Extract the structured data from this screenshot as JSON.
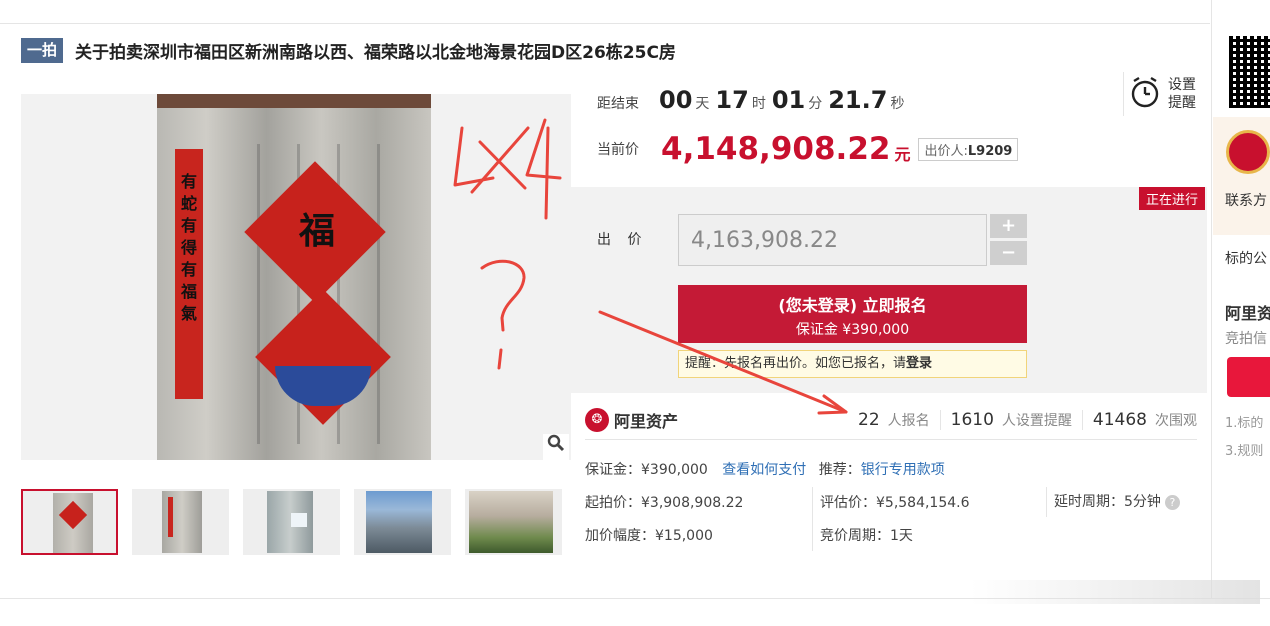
{
  "header": {
    "badge": "一拍",
    "title": "关于拍卖深圳市福田区新洲南路以西、福荣路以北金地海景花园D区26栋25C房"
  },
  "gallery": {
    "photo_text": {
      "couplet": "有蛇有得有福氣",
      "fu": "福"
    },
    "thumbnail_count": 5
  },
  "countdown": {
    "label": "距结束",
    "days": "00",
    "days_unit": "天",
    "hours": "17",
    "hours_unit": "时",
    "minutes": "01",
    "minutes_unit": "分",
    "seconds": "21.7",
    "seconds_unit": "秒"
  },
  "reminder": {
    "line1": "设置",
    "line2": "提醒"
  },
  "current_price": {
    "label": "当前价",
    "value": "4,148,908.22",
    "unit": "元",
    "bidder_label": "出价人:",
    "bidder_id": "L9209"
  },
  "bid": {
    "status_tag": "正在进行",
    "label": "出 价",
    "input_value": "4,163,908.22",
    "plus": "+",
    "minus": "−",
    "signup_line1": "(您未登录) 立即报名",
    "signup_line2": "保证金 ¥390,000",
    "tip_text": "提醒：先报名再出价。如您已报名，请",
    "tip_link": "登录"
  },
  "stats": {
    "platform": "阿里资产",
    "platform_icon": "alibaba-asset-icon",
    "signups": "22",
    "signups_label": "人报名",
    "reminders": "1610",
    "reminders_label": "人设置提醒",
    "views": "41468",
    "views_label": "次围观"
  },
  "details": {
    "deposit_label": "保证金：¥390,000",
    "pay_link": "查看如何支付",
    "recommend_label": "推荐：",
    "recommend_link": "银行专用款项",
    "start_price": "起拍价：¥3,908,908.22",
    "valuation": "评估价：¥5,584,154.6",
    "delay": "延时周期：5分钟",
    "increment": "加价幅度：¥15,000",
    "bid_period": "竞价周期：1天"
  },
  "sidebar": {
    "contact": "联系方",
    "announce": "标的公",
    "ali_heading": "阿里资",
    "ali_sub": "竞拍信",
    "link1": "1.标的",
    "link2": "3.规则"
  },
  "annotations": {
    "scribble": "以4?",
    "color": "#e8453c"
  },
  "colors": {
    "accent": "#c8102e",
    "badge": "#4f6a8f",
    "link": "#2f6fb5"
  }
}
